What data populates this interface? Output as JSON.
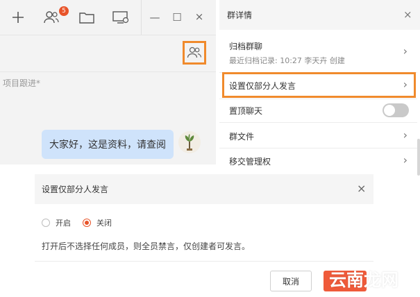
{
  "chat": {
    "badge_count": "5",
    "project_hint": "项目跟进*",
    "message": "大家好，这是资料，请查阅",
    "window_controls": {
      "minimize": "—",
      "maximize": "☐",
      "close": "×"
    },
    "toolbar_icons": [
      "plus-icon",
      "contacts-icon",
      "folder-icon",
      "screen-share-icon"
    ]
  },
  "group_details": {
    "title": "群详情",
    "close": "×",
    "archive": {
      "label": "归档群聊",
      "sub": "最近归档记录: 10:27 李天卉 创建"
    },
    "partial_speak": {
      "label": "设置仅部分人发言"
    },
    "pin_chat": {
      "label": "置顶聊天",
      "toggle_on": false
    },
    "group_files": {
      "label": "群文件"
    },
    "transfer_admin": {
      "label": "移交管理权"
    },
    "chevron": "›"
  },
  "dialog": {
    "title": "设置仅部分人发言",
    "close": "×",
    "options": [
      {
        "label": "开启",
        "checked": false
      },
      {
        "label": "关闭",
        "checked": true
      }
    ],
    "description": "打开后不选择任何成员，则全员禁言，仅创建者可发言。",
    "cancel_label": "取消"
  },
  "watermark": "云南龙网",
  "colors": {
    "accent": "#f08a2c",
    "primary": "#ef5a3a",
    "bubble": "#cfe3fb"
  }
}
